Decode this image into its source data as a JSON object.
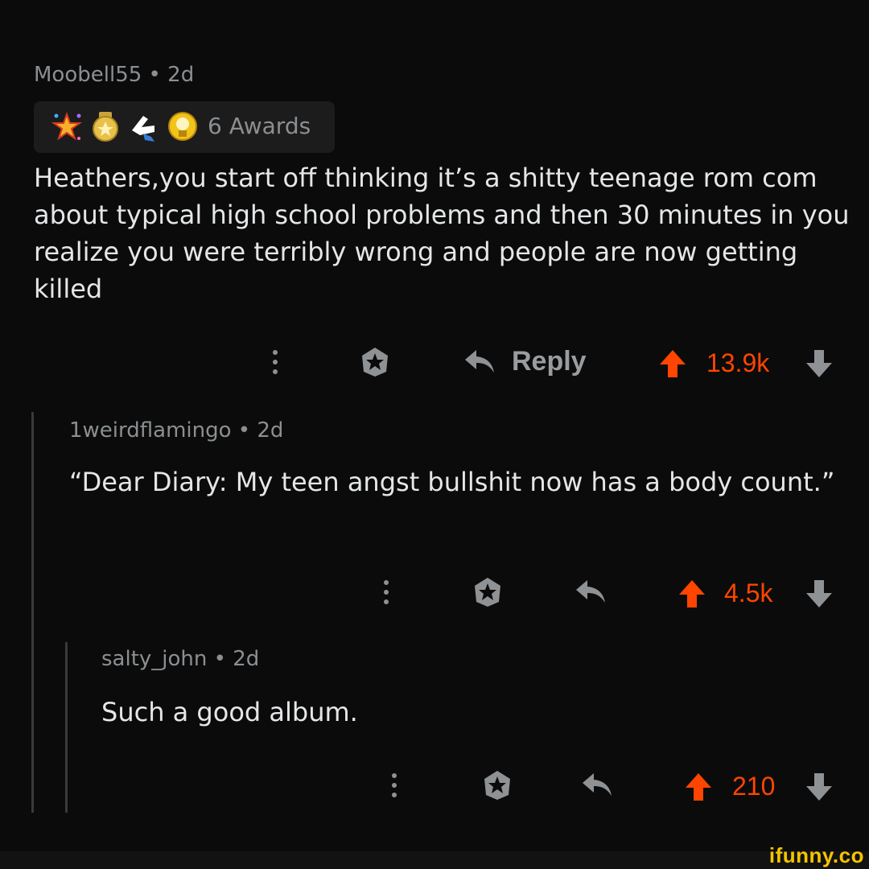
{
  "comments": [
    {
      "username": "Moobell55",
      "age": "2d",
      "awards_label": "6 Awards",
      "award_icons": [
        "sparkle-star-award-icon",
        "gold-medal-award-icon",
        "hands-award-icon",
        "gold-trophy-award-icon"
      ],
      "text": "Heathers,you start off thinking it’s a shitty teenage rom com about typical high school problems and then 30 minutes in you realize you were terribly wrong and people are now getting killed",
      "reply_label": "Reply",
      "score": "13.9k"
    },
    {
      "username": "1weirdflamingo",
      "age": "2d",
      "text": "“Dear Diary: My teen angst bullshit now has a body count.”",
      "score": "4.5k"
    },
    {
      "username": "salty_john",
      "age": "2d",
      "text": "Such a good album.",
      "score": "210"
    }
  ],
  "separator": "•",
  "watermark": "ifunny.co",
  "colors": {
    "background": "#0b0b0b",
    "upvote": "#ff4500",
    "meta": "#8b8f92",
    "icon": "#8f9295"
  }
}
